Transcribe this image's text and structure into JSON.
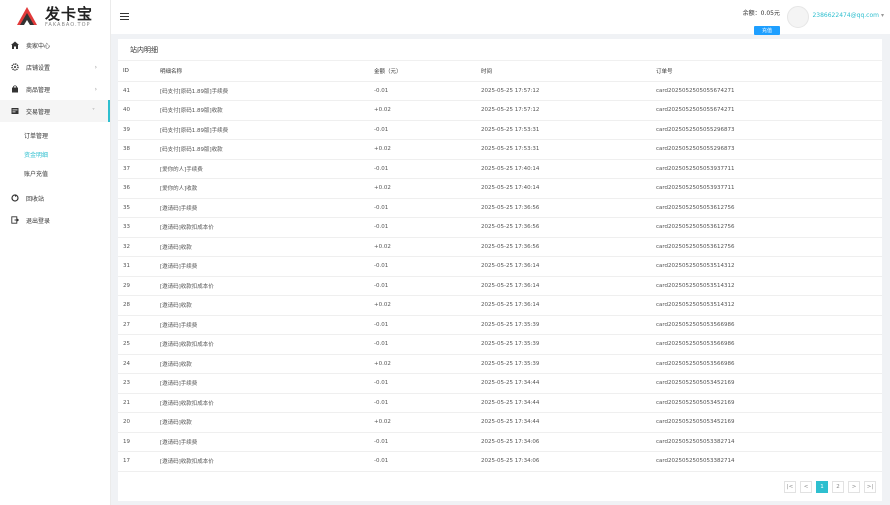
{
  "brand": {
    "name_cn": "发卡宝",
    "name_en": "FAKABAO.TOP",
    "primary": "#2ebfcf",
    "logo_red": "#e23a3a"
  },
  "sidebar": {
    "items": [
      {
        "label": "卖家中心",
        "icon": "home-icon"
      },
      {
        "label": "店铺设置",
        "icon": "gear-icon",
        "arrow": "›"
      },
      {
        "label": "商品管理",
        "icon": "bag-icon",
        "arrow": "›"
      },
      {
        "label": "交易管理",
        "icon": "trade-icon",
        "arrow": "˅"
      }
    ],
    "sub": [
      {
        "label": "订单管理"
      },
      {
        "label": "资金明细"
      },
      {
        "label": "账户充值"
      }
    ],
    "after": [
      {
        "label": "回收站",
        "icon": "recycle-icon"
      },
      {
        "label": "退出登录",
        "icon": "logout-icon"
      }
    ]
  },
  "header": {
    "balance": "余额：0.05元",
    "recharge": "充值",
    "user": "2386622474@qq.com",
    "caret": "▾"
  },
  "panel": {
    "title": "站内明细",
    "columns": [
      "ID",
      "明细名称",
      "金额（元）",
      "时间",
      "订单号"
    ],
    "rows": [
      [
        "41",
        "[码支付[原码1.89版]手续费",
        "-0.01",
        "2025-05-25 17:57:12",
        "card2025052505055674271"
      ],
      [
        "40",
        "[码支付[原码1.89版]收款",
        "+0.02",
        "2025-05-25 17:57:12",
        "card2025052505055674271"
      ],
      [
        "39",
        "[码支付[原码1.89版]手续费",
        "-0.01",
        "2025-05-25 17:53:31",
        "card2025052505055296873"
      ],
      [
        "38",
        "[码支付[原码1.89版]收款",
        "+0.02",
        "2025-05-25 17:53:31",
        "card2025052505055296873"
      ],
      [
        "37",
        "[爱你的人]手续费",
        "-0.01",
        "2025-05-25 17:40:14",
        "card2025052505053937711"
      ],
      [
        "36",
        "[爱你的人]收款",
        "+0.02",
        "2025-05-25 17:40:14",
        "card2025052505053937711"
      ],
      [
        "35",
        "[邀请码]手续费",
        "-0.01",
        "2025-05-25 17:36:56",
        "card2025052505053612756"
      ],
      [
        "33",
        "[邀请码]收款扣成本价",
        "-0.01",
        "2025-05-25 17:36:56",
        "card2025052505053612756"
      ],
      [
        "32",
        "[邀请码]收款",
        "+0.02",
        "2025-05-25 17:36:56",
        "card2025052505053612756"
      ],
      [
        "31",
        "[邀请码]手续费",
        "-0.01",
        "2025-05-25 17:36:14",
        "card2025052505053514312"
      ],
      [
        "29",
        "[邀请码]收款扣成本价",
        "-0.01",
        "2025-05-25 17:36:14",
        "card2025052505053514312"
      ],
      [
        "28",
        "[邀请码]收款",
        "+0.02",
        "2025-05-25 17:36:14",
        "card2025052505053514312"
      ],
      [
        "27",
        "[邀请码]手续费",
        "-0.01",
        "2025-05-25 17:35:39",
        "card2025052505053566986"
      ],
      [
        "25",
        "[邀请码]收款扣成本价",
        "-0.01",
        "2025-05-25 17:35:39",
        "card2025052505053566986"
      ],
      [
        "24",
        "[邀请码]收款",
        "+0.02",
        "2025-05-25 17:35:39",
        "card2025052505053566986"
      ],
      [
        "23",
        "[邀请码]手续费",
        "-0.01",
        "2025-05-25 17:34:44",
        "card2025052505053452169"
      ],
      [
        "21",
        "[邀请码]收款扣成本价",
        "-0.01",
        "2025-05-25 17:34:44",
        "card2025052505053452169"
      ],
      [
        "20",
        "[邀请码]收款",
        "+0.02",
        "2025-05-25 17:34:44",
        "card2025052505053452169"
      ],
      [
        "19",
        "[邀请码]手续费",
        "-0.01",
        "2025-05-25 17:34:06",
        "card2025052505053382714"
      ],
      [
        "17",
        "[邀请码]收款扣成本价",
        "-0.01",
        "2025-05-25 17:34:06",
        "card2025052505053382714"
      ]
    ]
  },
  "pager": {
    "first": "|<",
    "prev": "<",
    "pages": [
      "1",
      "2"
    ],
    "next": ">",
    "last": ">|"
  }
}
